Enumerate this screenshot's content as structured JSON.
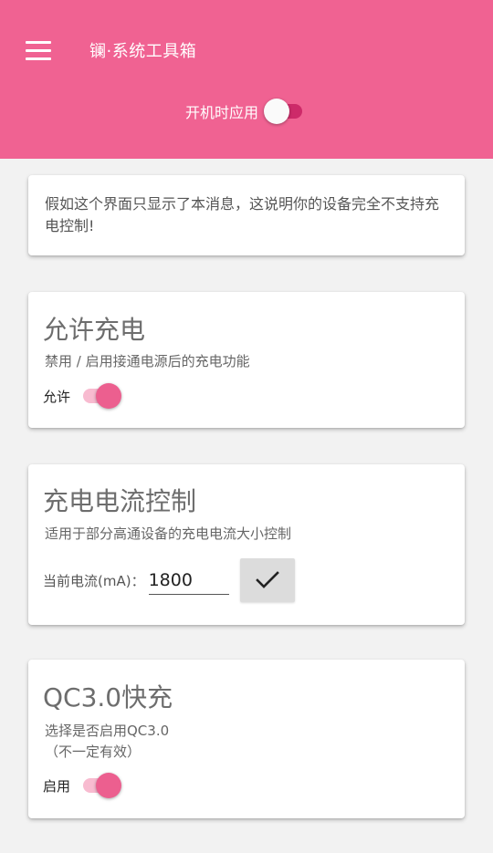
{
  "app": {
    "title": "镧·系统工具箱"
  },
  "boot": {
    "label": "开机时应用",
    "enabled": false
  },
  "notice": {
    "text": "假如这个界面只显示了本消息，这说明你的设备完全不支持充电控制!"
  },
  "charge": {
    "title": "允许充电",
    "description": "禁用 / 启用接通电源后的充电功能",
    "switch_label": "允许",
    "enabled": true
  },
  "current": {
    "title": "充电电流控制",
    "description": "适用于部分高通设备的充电电流大小控制",
    "field_label": "当前电流(mA)：",
    "value": "1800"
  },
  "qc": {
    "title": "QC3.0快充",
    "description_line1": "选择是否启用QC3.0",
    "description_line2": "（不一定有效）",
    "switch_label": "启用",
    "enabled": true
  },
  "colors": {
    "accent": "#f06292",
    "switch_on": "#ec5f8f",
    "background": "#f2f2f2"
  },
  "icons": {
    "menu": "hamburger-menu-icon",
    "apply": "checkmark-icon"
  }
}
